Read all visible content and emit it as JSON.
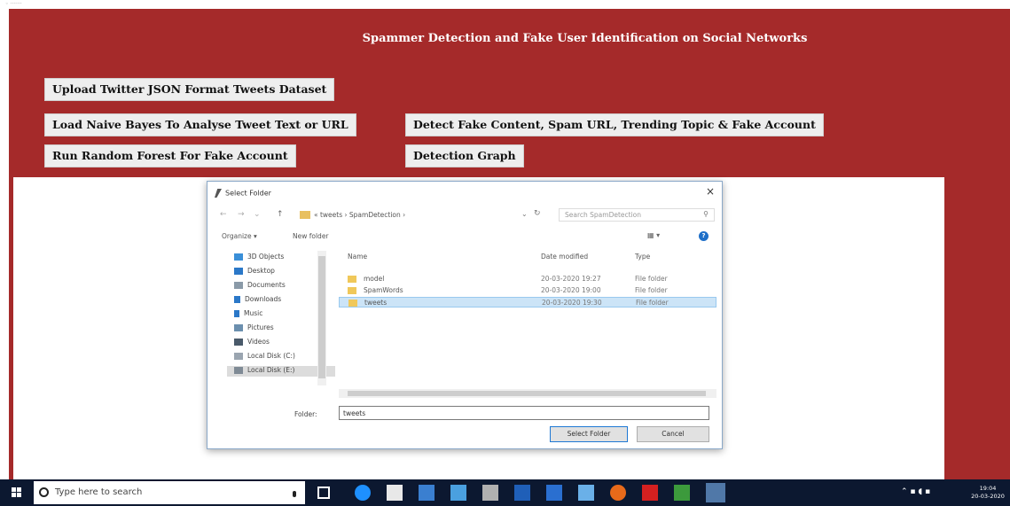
{
  "app": {
    "title": "Spammer Detection and Fake User Identification on Social Networks",
    "buttons": {
      "upload": "Upload Twitter JSON Format Tweets Dataset",
      "naive_bayes": "Load Naive Bayes To Analyse Tweet Text or URL",
      "detect": "Detect Fake Content, Spam URL, Trending Topic & Fake Account",
      "random_forest": "Run Random Forest For Fake Account",
      "graph": "Detection Graph"
    },
    "colors": {
      "background": "#a52a2a",
      "button": "#eeeeee"
    }
  },
  "dialog": {
    "title": "Select Folder",
    "close_icon": "×",
    "breadcrumb": "« tweets › SpamDetection ›",
    "search_placeholder": "Search SpamDetection",
    "toolbar": {
      "organize": "Organize ▾",
      "new_folder": "New folder"
    },
    "nav_items": [
      "3D Objects",
      "Desktop",
      "Documents",
      "Downloads",
      "Music",
      "Pictures",
      "Videos",
      "Local Disk (C:)",
      "Local Disk (E:)"
    ],
    "columns": {
      "name": "Name",
      "date": "Date modified",
      "type": "Type"
    },
    "files": [
      {
        "name": "model",
        "date": "20-03-2020 19:27",
        "type": "File folder"
      },
      {
        "name": "SpamWords",
        "date": "20-03-2020 19:00",
        "type": "File folder"
      },
      {
        "name": "tweets",
        "date": "20-03-2020 19:30",
        "type": "File folder"
      }
    ],
    "folder_label": "Folder:",
    "folder_value": "tweets",
    "select_button": "Select Folder",
    "cancel_button": "Cancel"
  },
  "taskbar": {
    "search_placeholder": "Type here to search",
    "clock_time": "19:04",
    "clock_date": "20-03-2020"
  }
}
